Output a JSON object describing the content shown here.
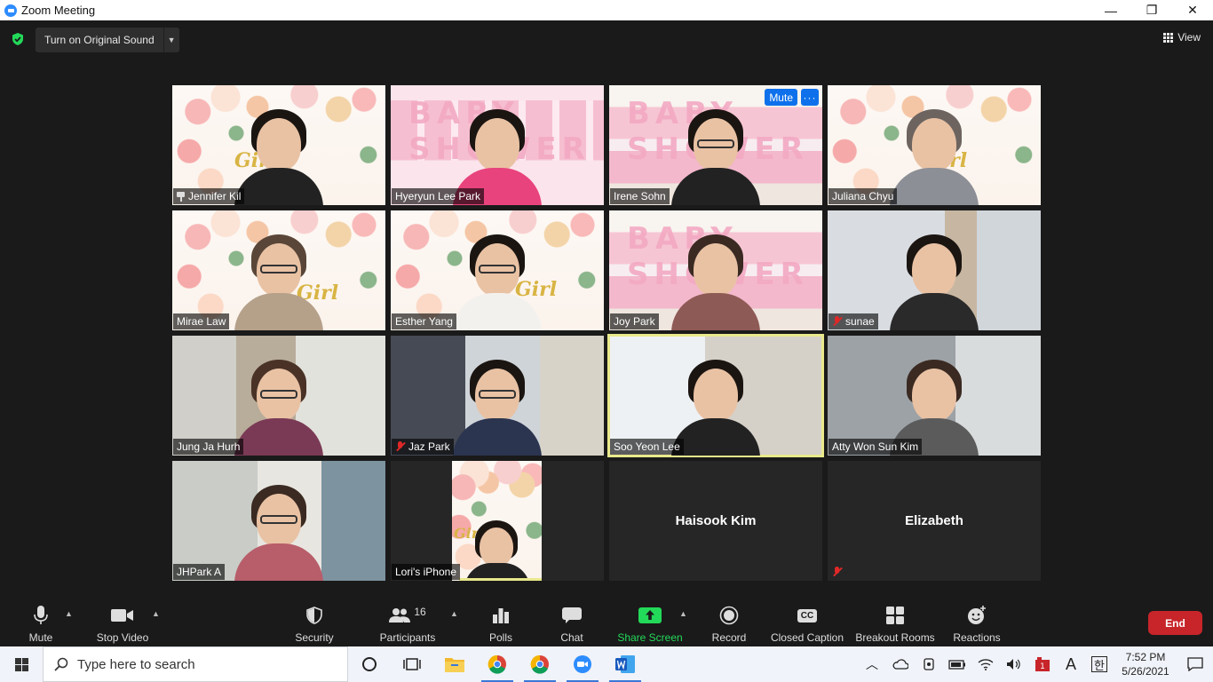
{
  "window": {
    "title": "Zoom Meeting",
    "minimize": "—",
    "restore": "❐",
    "close": "✕"
  },
  "top": {
    "original_sound_label": "Turn on Original Sound",
    "view_label": "View"
  },
  "tile_overlay": {
    "mute_label": "Mute",
    "more_label": "···"
  },
  "participants": [
    {
      "name": "Jennifer Kil",
      "pinned": true
    },
    {
      "name": "Hyeryun Lee Park"
    },
    {
      "name": "Irene Sohn"
    },
    {
      "name": "Juliana Chyu"
    },
    {
      "name": "Mirae Law"
    },
    {
      "name": "Esther Yang"
    },
    {
      "name": "Joy Park"
    },
    {
      "name": "sunae",
      "muted": true
    },
    {
      "name": "Jung Ja Hurh"
    },
    {
      "name": "Jaz Park",
      "muted": true
    },
    {
      "name": "Soo Yeon Lee",
      "active_speaker": true
    },
    {
      "name": "Atty Won Sun Kim"
    },
    {
      "name": "JHPark A"
    },
    {
      "name": "Lori's iPhone"
    },
    {
      "name": "Haisook Kim",
      "video_off": true
    },
    {
      "name": "Elizabeth",
      "video_off": true,
      "muted": true
    }
  ],
  "backgrounds": {
    "girl_text": "Girl",
    "baby_text": "BABY SHOWER"
  },
  "toolbar": {
    "mute": "Mute",
    "stop_video": "Stop Video",
    "security": "Security",
    "participants": "Participants",
    "participants_count": "16",
    "polls": "Polls",
    "chat": "Chat",
    "share_screen": "Share Screen",
    "record": "Record",
    "closed_caption": "Closed Caption",
    "closed_caption_badge": "CC",
    "breakout_rooms": "Breakout Rooms",
    "reactions": "Reactions",
    "end": "End",
    "accent_green": "#23d959",
    "end_red": "#c7252a"
  },
  "taskbar": {
    "search_placeholder": "Type here to search",
    "time": "7:52 PM",
    "date": "5/26/2021",
    "ime_letter": "A",
    "ime_hangul": "한"
  }
}
